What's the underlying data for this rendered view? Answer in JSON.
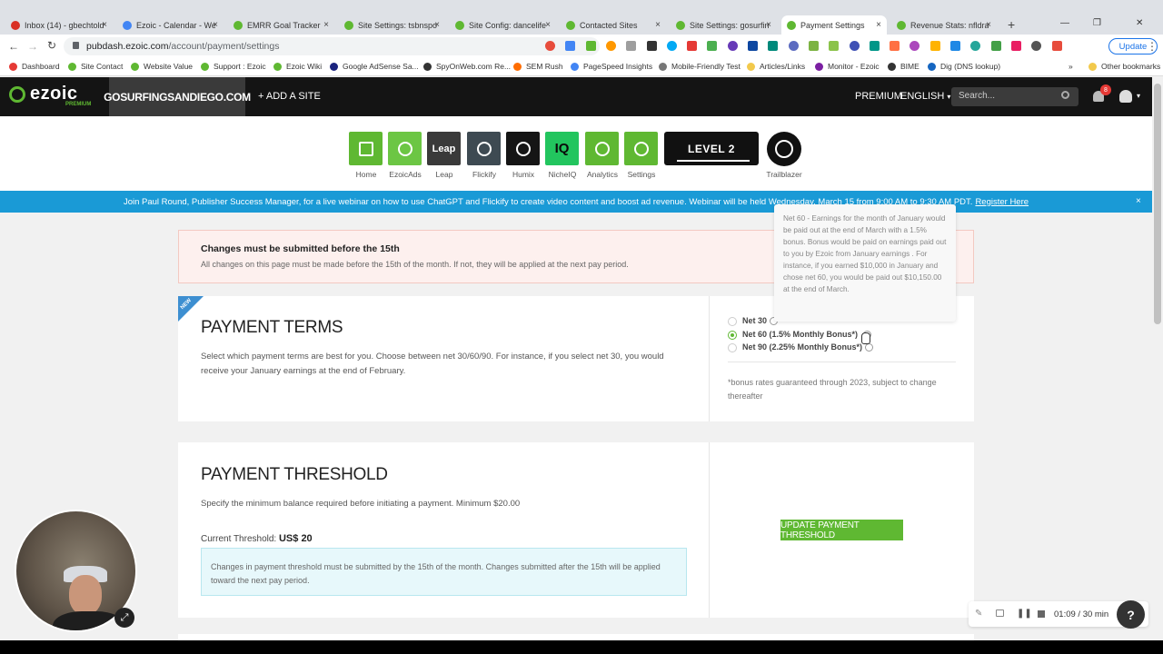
{
  "browser": {
    "tabs": [
      {
        "label": "Inbox (14) - gbechtold",
        "color": "#d93025"
      },
      {
        "label": "Ezoic - Calendar - We",
        "color": "#4285f4"
      },
      {
        "label": "EMRR Goal Tracker",
        "color": "#5fb832"
      },
      {
        "label": "Site Settings: tsbnspor",
        "color": "#5fb832"
      },
      {
        "label": "Site Config: dancelife",
        "color": "#5fb832"
      },
      {
        "label": "Contacted Sites",
        "color": "#5fb832"
      },
      {
        "label": "Site Settings: gosurfin",
        "color": "#5fb832"
      },
      {
        "label": "Payment Settings",
        "color": "#5fb832"
      },
      {
        "label": "Revenue Stats: nfldraft",
        "color": "#5fb832"
      }
    ],
    "url_domain": "pubdash.ezoic.com",
    "url_path": "/account/payment/settings",
    "update_label": "Update",
    "bookmarks": [
      {
        "label": "Dashboard",
        "color": "#e53935"
      },
      {
        "label": "Site Contact",
        "color": "#5fb832"
      },
      {
        "label": "Website Value",
        "color": "#5fb832"
      },
      {
        "label": "Support : Ezoic",
        "color": "#5fb832"
      },
      {
        "label": "Ezoic Wiki",
        "color": "#5fb832"
      },
      {
        "label": "Google AdSense Sa...",
        "color": "#1a237e"
      },
      {
        "label": "SpyOnWeb.com Re...",
        "color": "#333333"
      },
      {
        "label": "SEM Rush",
        "color": "#ff6d00"
      },
      {
        "label": "PageSpeed Insights",
        "color": "#4285f4"
      },
      {
        "label": "Mobile-Friendly Test",
        "color": "#777777"
      },
      {
        "label": "Articles/Links",
        "color": "#f2c94c"
      },
      {
        "label": "Monitor - Ezoic",
        "color": "#7b1fa2"
      },
      {
        "label": "BIME",
        "color": "#333333"
      },
      {
        "label": "Dig (DNS lookup)",
        "color": "#1565c0"
      },
      {
        "label": "Other bookmarks",
        "color": "#f2c94c"
      }
    ],
    "more_bookmarks": "»"
  },
  "header": {
    "logo": "ezoic",
    "logo_sub": "PREMIUM",
    "site": "GOSURFINGSANDIEGO.COM",
    "add_site": "+ ADD A SITE",
    "premium": "PREMIUM",
    "language": "ENGLISH",
    "search_placeholder": "Search...",
    "notif_count": "8"
  },
  "apps": [
    {
      "label": "Home",
      "icon": "home-icon",
      "color": "#5fb832"
    },
    {
      "label": "EzoicAds",
      "icon": "ezoicads-icon",
      "color": "#6cc644"
    },
    {
      "label": "Leap",
      "icon": "leap-icon",
      "color": "#3a3a3a",
      "glyph": "Leap"
    },
    {
      "label": "Flickify",
      "icon": "flickify-icon",
      "color": "#3e4a52"
    },
    {
      "label": "Humix",
      "icon": "humix-icon",
      "color": "#151515"
    },
    {
      "label": "NicheIQ",
      "icon": "nicheiq-icon",
      "color": "#22c55e",
      "glyph": "IQ"
    },
    {
      "label": "Analytics",
      "icon": "analytics-icon",
      "color": "#5fb832"
    },
    {
      "label": "Settings",
      "icon": "gear-icon",
      "color": "#5fb832"
    }
  ],
  "level_badge": "LEVEL 2",
  "trailblazer": "Trailblazer",
  "banner": {
    "text": "Join Paul Round, Publisher Success Manager, for a live webinar on how to use ChatGPT and Flickify to create video content and boost ad revenue. Webinar will be held Wednesday, March 15 from 9:00 AM to 9:30 AM PDT.",
    "link": "Register Here",
    "close": "×"
  },
  "alert": {
    "title": "Changes must be submitted before the 15th",
    "body": "All changes on this page must be made before the 15th of the month. If not, they will be applied at the next pay period."
  },
  "payment_terms": {
    "new_tag": "NEW",
    "title": "PAYMENT TERMS",
    "description": "Select which payment terms are best for you. Choose between net 30/60/90. For instance, if you select net 30, you would receive your January earnings at the end of February.",
    "options": [
      {
        "label": "Net 30",
        "selected": false
      },
      {
        "label": "Net 60 (1.5% Monthly Bonus*)",
        "selected": true
      },
      {
        "label": "Net 90 (2.25% Monthly Bonus*)",
        "selected": false
      }
    ],
    "bonus_note": "*bonus rates guaranteed through 2023, subject to change thereafter",
    "tooltip": "Net 60 - Earnings for the month of January would be paid out at the end of March with a 1.5% bonus. Bonus would be paid on earnings paid out to you by Ezoic from January earnings . For instance, if you earned $10,000 in January and chose net 60, you would be paid out $10,150.00 at the end of March."
  },
  "payment_threshold": {
    "title": "PAYMENT THRESHOLD",
    "description": "Specify the minimum balance required before initiating a payment. Minimum $20.00",
    "current_label": "Current Threshold:",
    "current_value": "US$ 20",
    "info": "Changes in payment threshold must be submitted by the 15th of the month. Changes submitted after the 15th will be applied toward the next pay period.",
    "button": "UPDATE PAYMENT THRESHOLD"
  },
  "recorder": {
    "time": "01:09 / 30 min",
    "help": "?"
  }
}
